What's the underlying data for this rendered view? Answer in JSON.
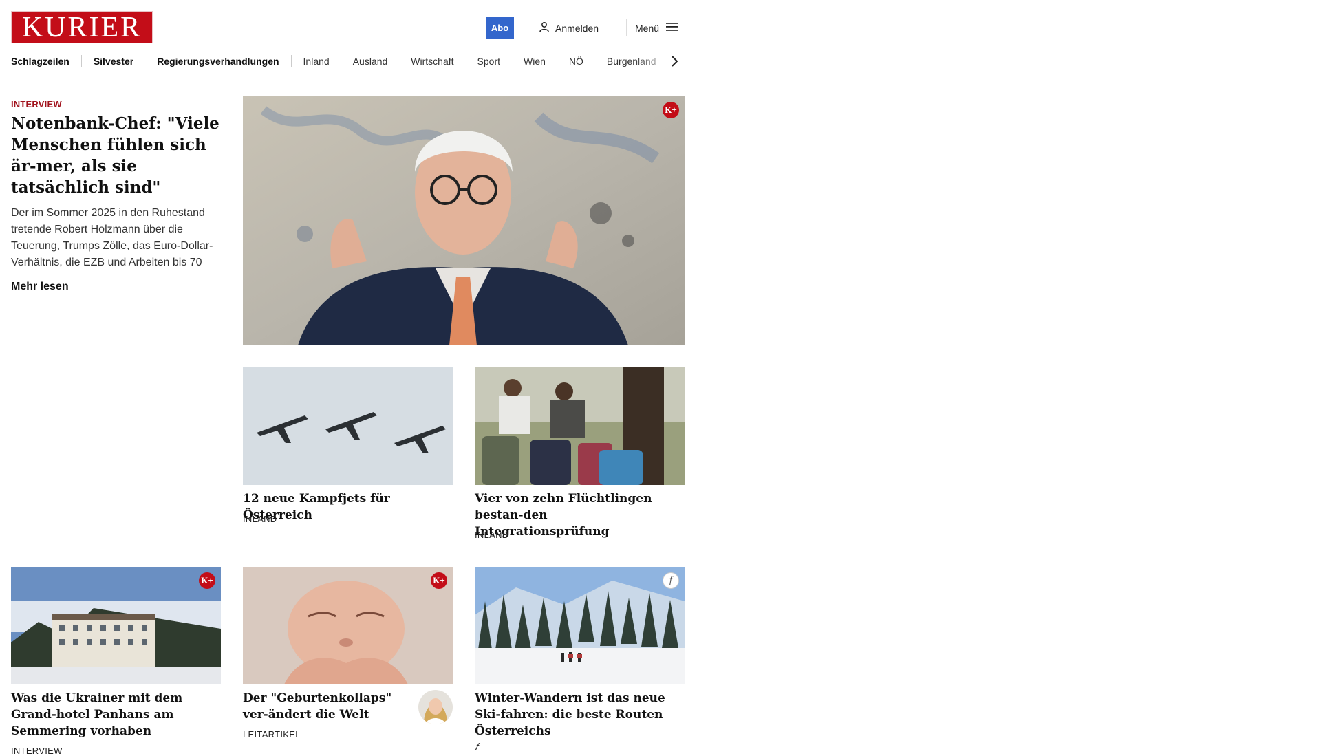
{
  "brand": {
    "logo_text": "KURIER",
    "color": "#c30d18"
  },
  "header": {
    "abo_label": "Abo",
    "login_label": "Anmelden",
    "menu_label": "Menü",
    "accent_color": "#3366cc"
  },
  "nav": {
    "items": [
      {
        "label": "Schlagzeilen"
      },
      {
        "label": "Silvester"
      },
      {
        "label": "Regierungsverhandlungen"
      },
      {
        "label": "Inland"
      },
      {
        "label": "Ausland"
      },
      {
        "label": "Wirtschaft"
      },
      {
        "label": "Sport"
      },
      {
        "label": "Wien"
      },
      {
        "label": "NÖ"
      },
      {
        "label": "Burgenland"
      }
    ]
  },
  "lead": {
    "kicker": "INTERVIEW",
    "title": "Notenbank-Chef: \"Viele Menschen fühlen sich är-mer, als sie tatsächlich sind\"",
    "teaser": "Der im Sommer 2025 in den Ruhestand tretende Robert Holzmann über die Teuerung, Trumps Zölle, das Euro-Dollar-Verhältnis, die EZB und Arbeiten bis 70",
    "more_label": "Mehr lesen",
    "badge": "K+"
  },
  "cards": [
    {
      "title": "12 neue Kampfjets für Österreich",
      "category": "INLAND"
    },
    {
      "title": "Vier von zehn Flüchtlingen bestan-den Integrationsprüfung",
      "category": "INLAND"
    },
    {
      "title": "Was die Ukrainer mit dem Grand-hotel Panhans am Semmering vorhaben",
      "category": "INTERVIEW",
      "badge": "K+"
    },
    {
      "title": "Der \"Geburtenkollaps\" ver-ändert die Welt",
      "category": "LEITARTIKEL",
      "badge": "K+"
    },
    {
      "title": "Winter-Wandern ist das neue Ski-fahren: die beste Routen Österreichs",
      "category": "",
      "badge": "f"
    }
  ],
  "icons": [
    "user-icon",
    "hamburger-menu-icon",
    "chevron-right-icon",
    "kplus-badge-icon",
    "freizeit-badge-icon"
  ]
}
